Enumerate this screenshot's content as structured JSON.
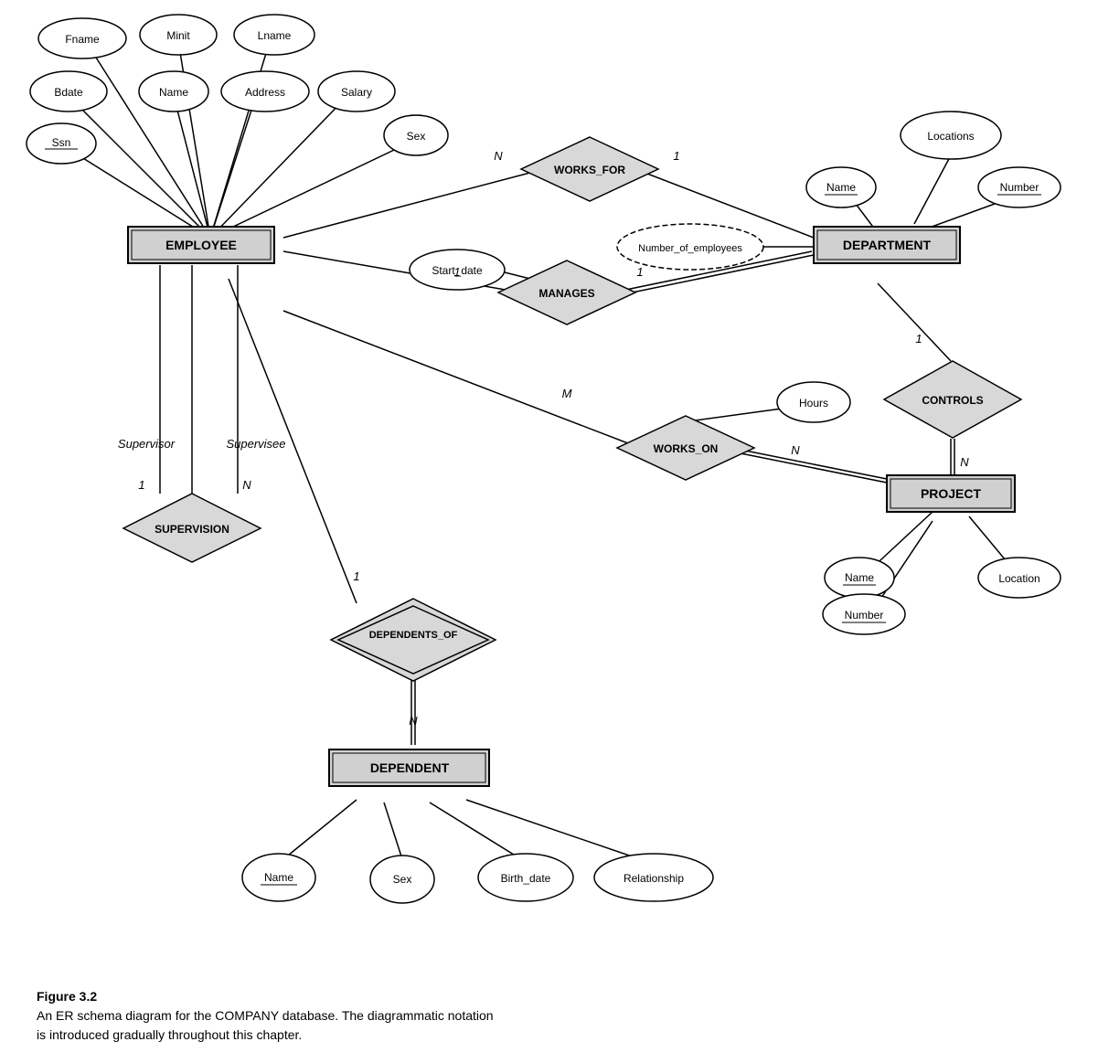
{
  "caption": {
    "title": "Figure 3.2",
    "line1": "An ER schema diagram for the COMPANY database. The diagrammatic notation",
    "line2": "is introduced gradually throughout this chapter."
  },
  "entities": {
    "employee": "EMPLOYEE",
    "department": "DEPARTMENT",
    "project": "PROJECT",
    "dependent": "DEPENDENT"
  },
  "relationships": {
    "works_for": "WORKS_FOR",
    "manages": "MANAGES",
    "works_on": "WORKS_ON",
    "controls": "CONTROLS",
    "supervision": "SUPERVISION",
    "dependents_of": "DEPENDENTS_OF"
  },
  "attributes": {
    "fname": "Fname",
    "minit": "Minit",
    "lname": "Lname",
    "bdate": "Bdate",
    "name_emp": "Name",
    "address": "Address",
    "salary": "Salary",
    "ssn": "Ssn",
    "sex_emp": "Sex",
    "start_date": "Start_date",
    "locations": "Locations",
    "dept_name": "Name",
    "dept_number": "Number",
    "num_employees": "Number_of_employees",
    "hours": "Hours",
    "proj_name": "Name",
    "proj_number": "Number",
    "proj_location": "Location",
    "dep_name": "Name",
    "dep_sex": "Sex",
    "dep_birthdate": "Birth_date",
    "dep_relationship": "Relationship"
  },
  "cardinalities": {
    "n": "N",
    "m": "M",
    "one": "1"
  }
}
